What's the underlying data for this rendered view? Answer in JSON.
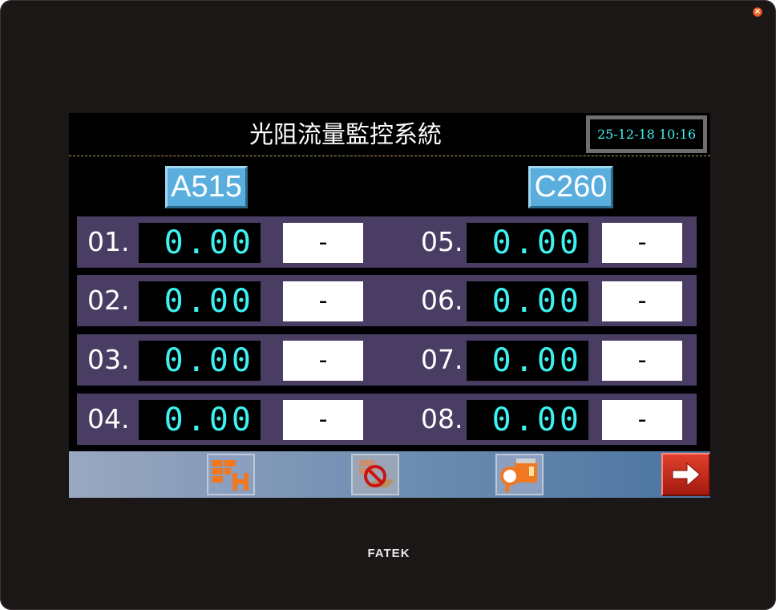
{
  "window": {
    "close_icon": "close-icon",
    "brand": "FATEK"
  },
  "header": {
    "title": "光阻流量監控系統",
    "datetime": "25-12-18 10:16"
  },
  "groups": {
    "left": "A515",
    "right": "C260"
  },
  "rows": [
    {
      "left": {
        "label": "01.",
        "value": "0.00",
        "state": "-"
      },
      "right": {
        "label": "05.",
        "value": "0.00",
        "state": "-"
      }
    },
    {
      "left": {
        "label": "02.",
        "value": "0.00",
        "state": "-"
      },
      "right": {
        "label": "06.",
        "value": "0.00",
        "state": "-"
      }
    },
    {
      "left": {
        "label": "03.",
        "value": "0.00",
        "state": "-"
      },
      "right": {
        "label": "07.",
        "value": "0.00",
        "state": "-"
      }
    },
    {
      "left": {
        "label": "04.",
        "value": "0.00",
        "state": "-"
      },
      "right": {
        "label": "08.",
        "value": "0.00",
        "state": "-"
      }
    }
  ],
  "toolbar": {
    "icons": [
      "grid-h-icon",
      "no-entry-icon",
      "search-device-icon",
      "arrow-right-icon"
    ]
  },
  "colors": {
    "digit": "#3ef2f2",
    "row_bg": "#4a3d63",
    "accent_red": "#c42a1a",
    "group_btn": "#5aaede"
  }
}
